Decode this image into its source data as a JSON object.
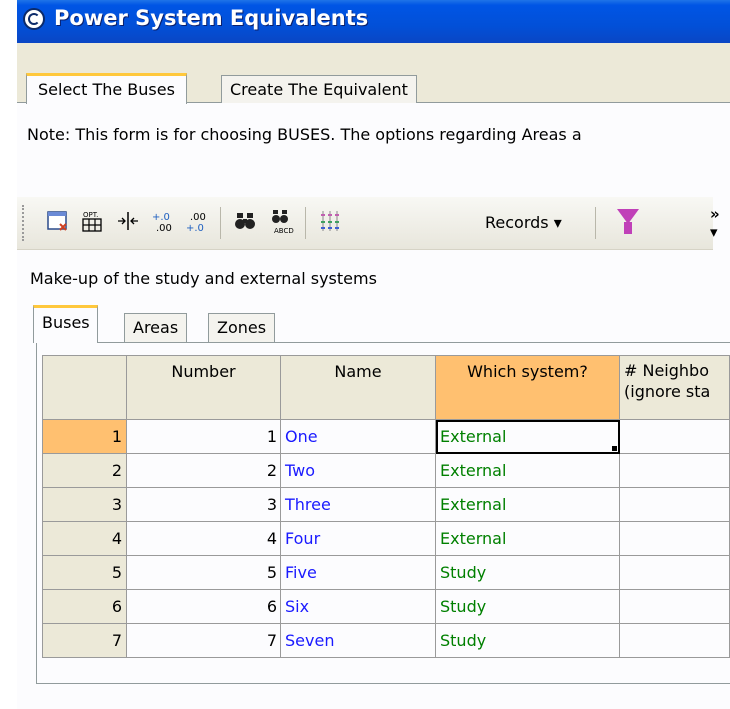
{
  "window": {
    "title": "Power System Equivalents"
  },
  "top_tabs": [
    {
      "label": "Select The Buses",
      "active": true
    },
    {
      "label": "Create The Equivalent",
      "active": false
    }
  ],
  "note": "Note: This form is for choosing BUSES.  The options regarding Areas a",
  "toolbar": {
    "records_label": "Records ▾",
    "icons": [
      "table-options-icon",
      "insert-columns-icon",
      "decimal-increase-icon",
      "decimal-decrease-icon",
      "find-icon",
      "find-abcd-icon",
      "sort-icon",
      "records-menu",
      "filter-icon",
      "more-chevron-icon"
    ]
  },
  "caption": "Make-up of the study and external systems",
  "inner_tabs": [
    {
      "label": "Buses",
      "active": true
    },
    {
      "label": "Areas",
      "active": false
    },
    {
      "label": "Zones",
      "active": false
    }
  ],
  "grid": {
    "columns": [
      "Number",
      "Name",
      "Which system?",
      "# Neighbo\n(ignore sta"
    ],
    "rows": [
      {
        "row": "1",
        "number": "1",
        "name": "One",
        "system": "External"
      },
      {
        "row": "2",
        "number": "2",
        "name": "Two",
        "system": "External"
      },
      {
        "row": "3",
        "number": "3",
        "name": "Three",
        "system": "External"
      },
      {
        "row": "4",
        "number": "4",
        "name": "Four",
        "system": "External"
      },
      {
        "row": "5",
        "number": "5",
        "name": "Five",
        "system": "Study"
      },
      {
        "row": "6",
        "number": "6",
        "name": "Six",
        "system": "Study"
      },
      {
        "row": "7",
        "number": "7",
        "name": "Seven",
        "system": "Study"
      }
    ]
  },
  "colors": {
    "title_bar": "#0250d8",
    "selected_header": "#ffc070",
    "name_text": "#1a1aff",
    "system_text": "#008000",
    "active_tab_accent": "#ffc83c"
  }
}
